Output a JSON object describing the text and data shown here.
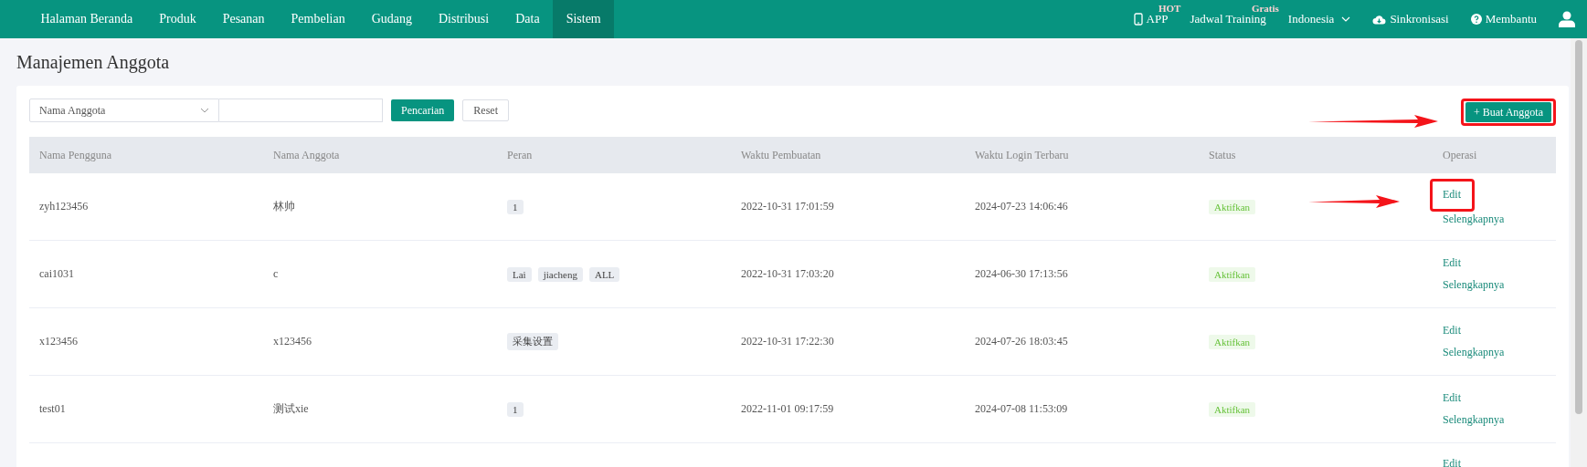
{
  "nav": {
    "items": [
      {
        "label": "Halaman Beranda",
        "selected": false
      },
      {
        "label": "Produk",
        "selected": false
      },
      {
        "label": "Pesanan",
        "selected": false
      },
      {
        "label": "Pembelian",
        "selected": false
      },
      {
        "label": "Gudang",
        "selected": false
      },
      {
        "label": "Distribusi",
        "selected": false
      },
      {
        "label": "Data",
        "selected": false
      },
      {
        "label": "Sistem",
        "selected": true
      }
    ],
    "right": [
      {
        "kind": "phone",
        "label": "APP",
        "badge": "HOT"
      },
      {
        "kind": "plain",
        "label": "Jadwal Training",
        "badge": "Gratis"
      },
      {
        "kind": "dropdown",
        "label": "Indonesia"
      },
      {
        "kind": "cloud",
        "label": "Sinkronisasi"
      },
      {
        "kind": "help",
        "label": "Membantu"
      },
      {
        "kind": "user"
      }
    ]
  },
  "page_title": "Manajemen Anggota",
  "filter": {
    "field_select": "Nama Anggota",
    "search_button": "Pencarian",
    "reset_button": "Reset"
  },
  "create_button": {
    "label": "+ Buat Anggota",
    "highlighted": true
  },
  "table": {
    "columns": [
      "Nama Pengguna",
      "Nama Anggota",
      "Peran",
      "Waktu Pembuatan",
      "Waktu Login Terbaru",
      "Status",
      "Operasi"
    ],
    "rows": [
      {
        "username": "zyh123456",
        "member_name": "林帅",
        "roles": [
          "1"
        ],
        "created": "2022-10-31 17:01:59",
        "last_login": "2024-07-23 14:06:46",
        "status": "Aktifkan",
        "operations": [
          "Edit",
          "Selengkapnya"
        ],
        "edit_highlighted": true
      },
      {
        "username": "cai1031",
        "member_name": "c",
        "roles": [
          "Lai",
          "jiacheng",
          "ALL"
        ],
        "created": "2022-10-31 17:03:20",
        "last_login": "2024-06-30 17:13:56",
        "status": "Aktifkan",
        "operations": [
          "Edit",
          "Selengkapnya"
        ],
        "edit_highlighted": false
      },
      {
        "username": "x123456",
        "member_name": "x123456",
        "roles": [
          "采集设置"
        ],
        "created": "2022-10-31 17:22:30",
        "last_login": "2024-07-26 18:03:45",
        "status": "Aktifkan",
        "operations": [
          "Edit",
          "Selengkapnya"
        ],
        "edit_highlighted": false
      },
      {
        "username": "test01",
        "member_name": "测试xie",
        "roles": [
          "1"
        ],
        "created": "2022-11-01 09:17:59",
        "last_login": "2024-07-08 11:53:09",
        "status": "Aktifkan",
        "operations": [
          "Edit",
          "Selengkapnya"
        ],
        "edit_highlighted": false
      },
      {
        "operations": [
          "Edit"
        ]
      }
    ]
  }
}
